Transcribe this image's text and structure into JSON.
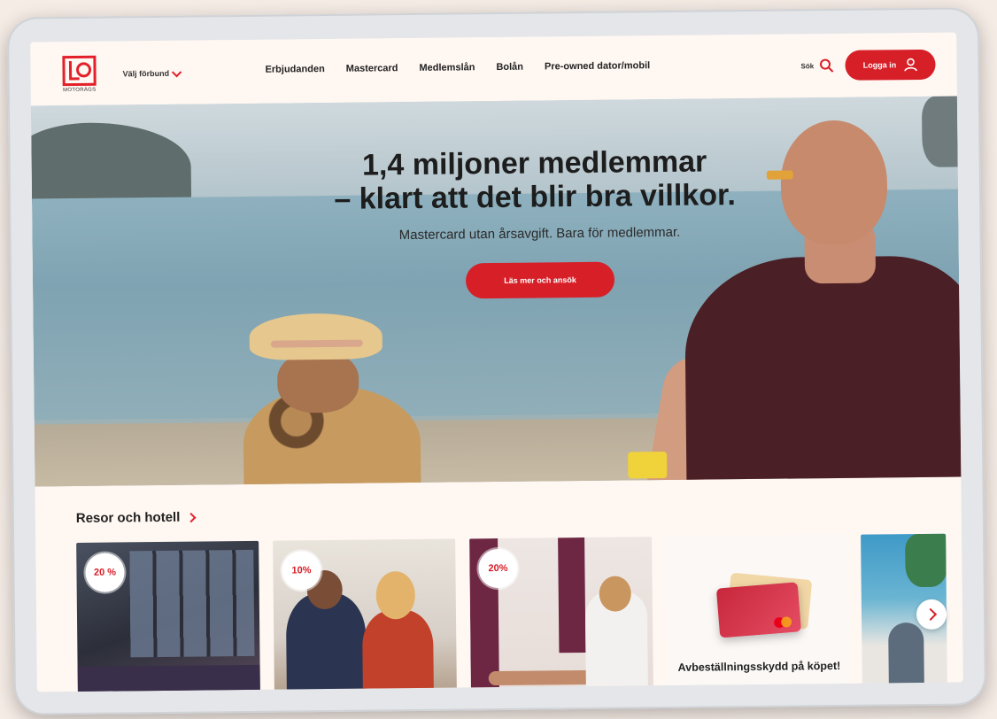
{
  "header": {
    "logo_text": "MOTORÄGS",
    "union_select": "Välj förbund",
    "nav": [
      "Erbjudanden",
      "Mastercard",
      "Medlemslån",
      "Bolån",
      "Pre-owned dator/mobil"
    ],
    "search_label": "Sök",
    "login_label": "Logga in"
  },
  "hero": {
    "title_line1": "1,4 miljoner medlemmar",
    "title_line2": "– klart att det blir bra villkor.",
    "subtitle": "Mastercard utan årsavgift. Bara för medlemmar.",
    "cta_label": "Läs mer och ansök"
  },
  "section": {
    "title": "Resor och hotell",
    "cards": [
      {
        "badge": "20 %"
      },
      {
        "badge": "10%"
      },
      {
        "badge": "20%"
      },
      {
        "text": "Avbeställningsskydd på köpet!"
      },
      {}
    ]
  },
  "colors": {
    "brand_red": "#d71f28",
    "background": "#fff7f2"
  }
}
